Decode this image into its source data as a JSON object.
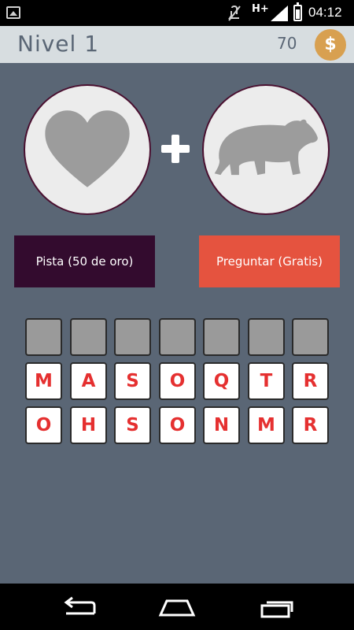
{
  "status_bar": {
    "network": "H+",
    "time": "04:12"
  },
  "header": {
    "level_label": "Nivel 1",
    "coins": "70",
    "coin_symbol": "$"
  },
  "pictures": [
    {
      "icon": "heart-icon"
    },
    {
      "icon": "bear-icon"
    }
  ],
  "buttons": {
    "hint_label": "Pista (50 de oro)",
    "ask_label": "Preguntar (Gratis)"
  },
  "answer_slots": 7,
  "letters_row1": [
    "M",
    "A",
    "S",
    "O",
    "Q",
    "T",
    "R"
  ],
  "letters_row2": [
    "O",
    "H",
    "S",
    "O",
    "N",
    "M",
    "R"
  ],
  "colors": {
    "background": "#5a6675",
    "header_bg": "#d7dde0",
    "hint_button": "#330b2e",
    "ask_button": "#e5533f",
    "coin": "#d8a050",
    "letter": "#e53030"
  }
}
